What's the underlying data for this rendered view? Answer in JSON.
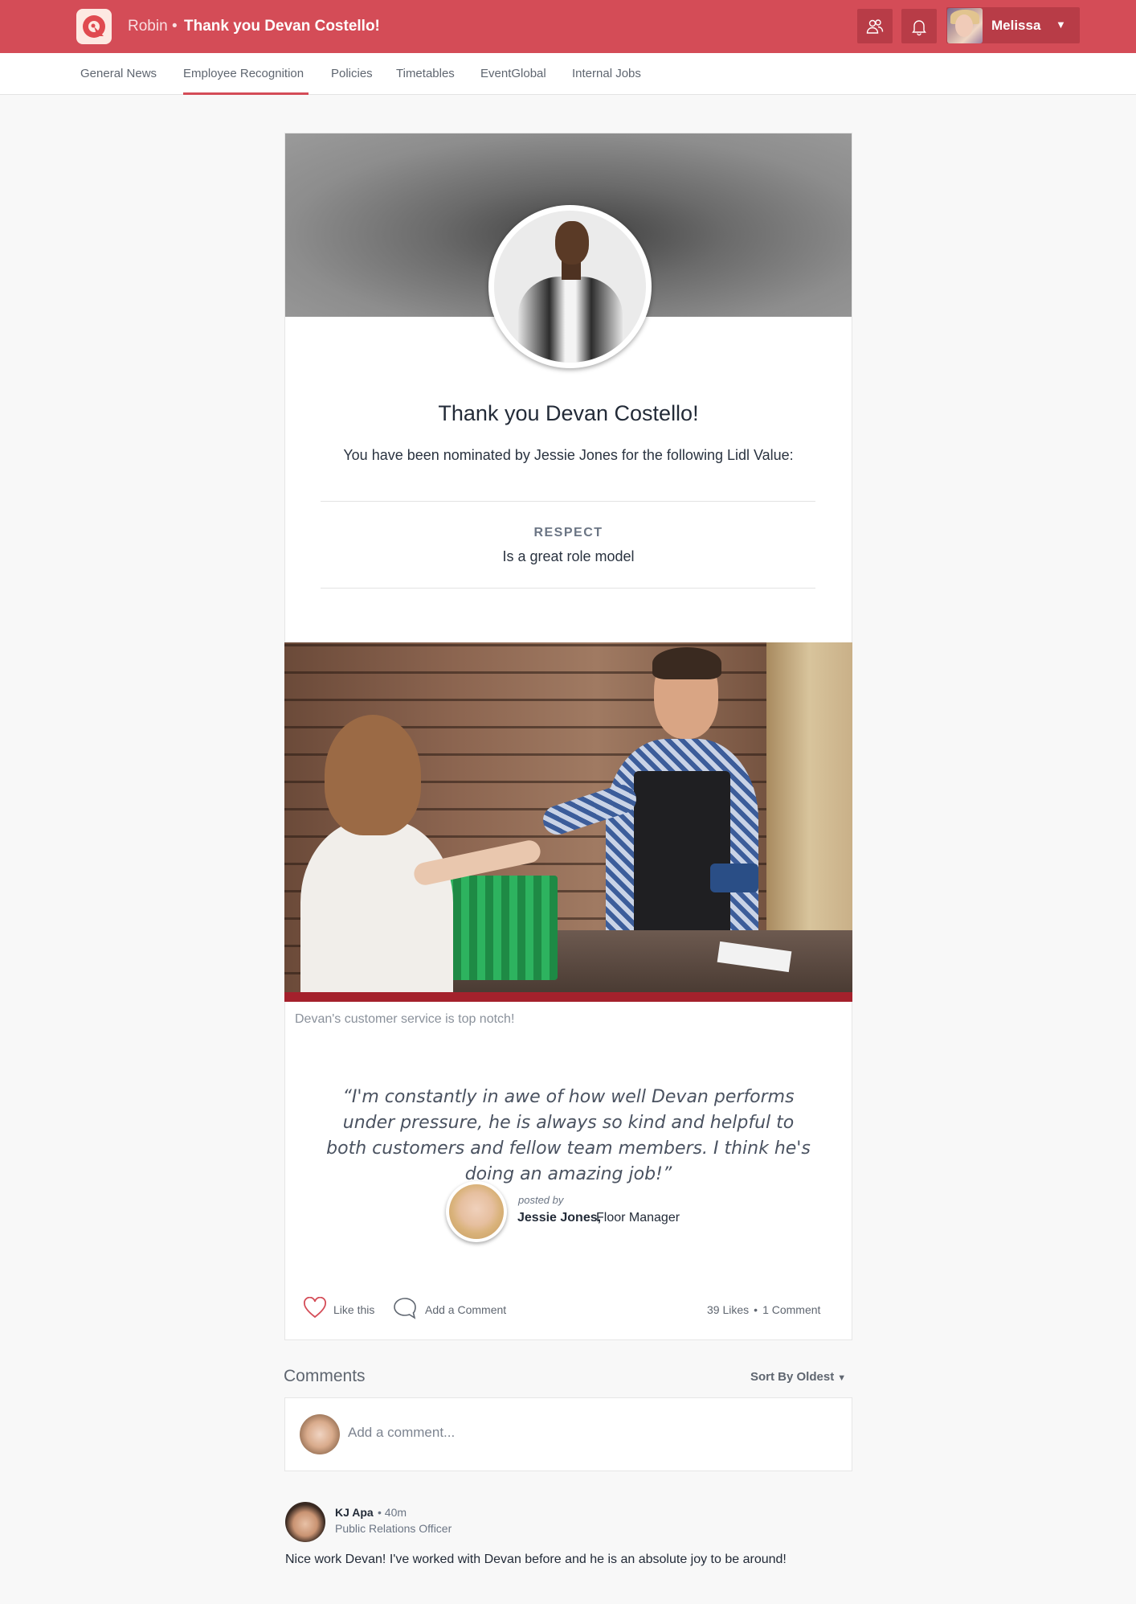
{
  "header": {
    "brand": "Robin",
    "separator": "•",
    "page_title": "Thank you Devan Costello!",
    "user_name": "Melissa",
    "user_caret": "▼",
    "accent_color": "#d44c57",
    "icons": [
      "logo-icon",
      "people-icon",
      "bell-icon",
      "chevron-down-icon"
    ]
  },
  "subnav": {
    "items": [
      {
        "label": "General News"
      },
      {
        "label": "Employee Recognition",
        "active": true
      },
      {
        "label": "Policies"
      },
      {
        "label": "Timetables"
      },
      {
        "label": "EventGlobal"
      },
      {
        "label": "Internal Jobs"
      }
    ]
  },
  "post": {
    "title": "Thank you Devan Costello!",
    "subtitle": "You have been nominated by Jessie Jones for the following Lidl Value:",
    "value_title": "RESPECT",
    "value_desc": "Is a great role model",
    "photo_caption": "Devan's customer service is top notch!",
    "quote": "“I'm constantly in awe of how well Devan performs under pressure, he is always so kind and helpful to both customers and fellow team members. I think he's doing an amazing job!”",
    "posted_by_label": "posted by",
    "poster_name": "Jessie Jones,",
    "poster_role": "Floor Manager",
    "like_label": "Like this",
    "comment_label": "Add a Comment",
    "likes_count": "39 Likes",
    "stats_dot": "•",
    "comments_count": "1 Comment"
  },
  "comments": {
    "title": "Comments",
    "sort_label": "Sort By Oldest",
    "sort_caret": "▼",
    "input_placeholder": "Add a comment...",
    "items": [
      {
        "author": "KJ Apa",
        "time": "• 40m",
        "role": "Public Relations Officer",
        "text": "Nice work Devan! I've worked with Devan before and he is an absolute joy to be around!"
      }
    ]
  }
}
